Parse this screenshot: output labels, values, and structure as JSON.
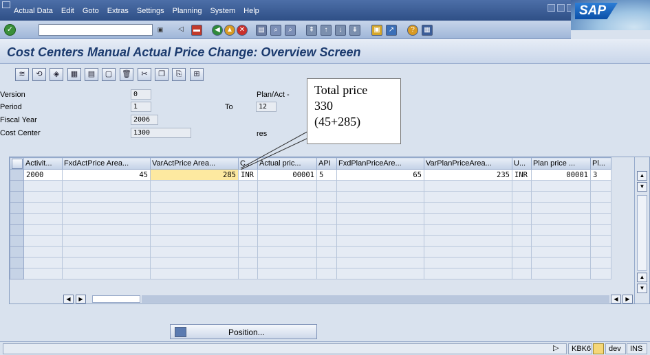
{
  "menu": [
    {
      "label": "Actual Data",
      "u": 1
    },
    {
      "label": "Edit"
    },
    {
      "label": "Goto"
    },
    {
      "label": "Extras"
    },
    {
      "label": "Settings"
    },
    {
      "label": "Planning"
    },
    {
      "label": "System"
    },
    {
      "label": "Help"
    }
  ],
  "logo": "SAP",
  "title": "Cost Centers Manual Actual Price Change: Overview Screen",
  "header": {
    "version_label": "Version",
    "version_value": "0",
    "period_label": "Period",
    "period_from": "1",
    "to_label": "To",
    "period_to": "12",
    "fiscal_year_label": "Fiscal Year",
    "fiscal_year_value": "2006",
    "cost_center_label": "Cost Center",
    "cost_center_value": "1300",
    "plan_act_label": "Plan/Act -",
    "res_label": "res"
  },
  "callout": {
    "line1": "Total price",
    "line2": "330",
    "line3": "(45+285)"
  },
  "grid": {
    "columns": [
      "Activit...",
      "FxdActPrice Area...",
      "VarActPrice Area...",
      "C...",
      "Actual pric...",
      "API",
      "FxdPlanPriceAre...",
      "VarPlanPriceArea...",
      "U...",
      "Plan price ...",
      "Pl..."
    ],
    "rows": [
      [
        "2000",
        "45",
        "285",
        "INR",
        "00001",
        "5",
        "65",
        "235",
        "INR",
        "00001",
        "3"
      ]
    ]
  },
  "position_button": "Position...",
  "status": {
    "tcode": "KBK6",
    "server": "dev",
    "mode": "INS"
  }
}
